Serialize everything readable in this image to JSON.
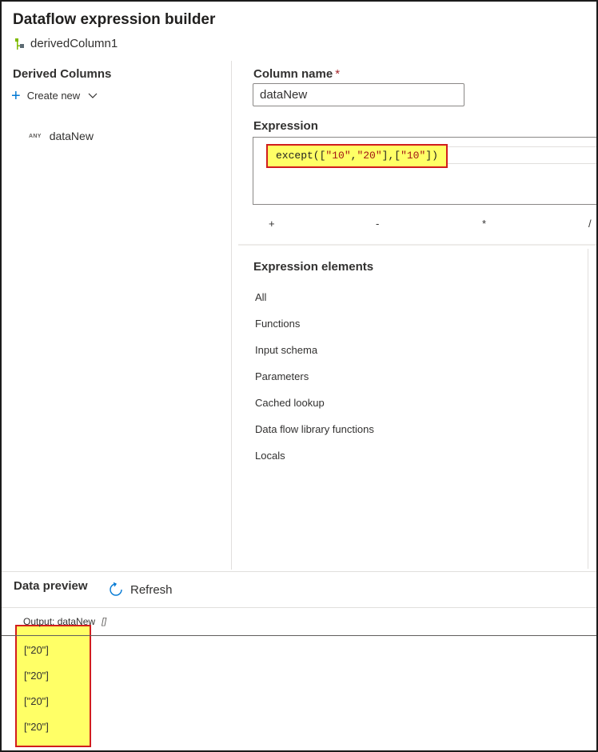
{
  "header": {
    "title": "Dataflow expression builder",
    "subtitle": "derivedColumn1"
  },
  "derived_columns": {
    "heading": "Derived Columns",
    "create_new_label": "Create new",
    "items": [
      {
        "type_badge": "ANY",
        "name": "dataNew"
      }
    ]
  },
  "column_name": {
    "label": "Column name",
    "required_mark": "*",
    "value": "dataNew"
  },
  "expression": {
    "label": "Expression",
    "code": {
      "func": "except([",
      "s1": "\"10\"",
      "comma1": ",",
      "s2": "\"20\"",
      "mid": "],[",
      "s3": "\"10\"",
      "end": "])"
    }
  },
  "operators": [
    "+",
    "-",
    "*",
    "/"
  ],
  "expression_elements": {
    "heading": "Expression elements",
    "items": [
      "All",
      "Functions",
      "Input schema",
      "Parameters",
      "Cached lookup",
      "Data flow library functions",
      "Locals"
    ]
  },
  "data_preview": {
    "title": "Data preview",
    "refresh_label": "Refresh",
    "output_label": "Output: dataNew",
    "output_type": "[]",
    "rows": [
      "[\"20\"]",
      "[\"20\"]",
      "[\"20\"]",
      "[\"20\"]"
    ]
  },
  "colors": {
    "accent": "#0078d4",
    "highlight_fill": "#ffff66",
    "highlight_border": "#d11d1d",
    "string_literal": "#a31515"
  }
}
